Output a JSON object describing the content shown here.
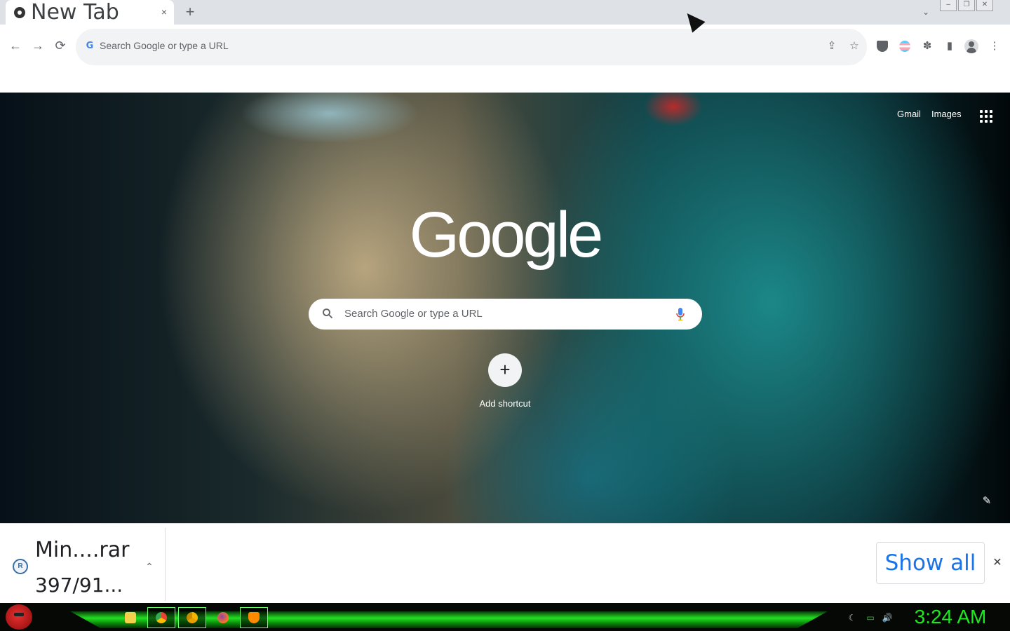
{
  "browser": {
    "tab": {
      "title": "New Tab",
      "close_icon": "×"
    },
    "new_tab_icon": "+",
    "tab_search_icon": "⌄",
    "window_controls": [
      "–",
      "❐",
      "✕"
    ],
    "nav": {
      "back_icon": "←",
      "forward_icon": "→",
      "reload_icon": "⟳"
    },
    "omnibox": {
      "placeholder": "Search Google or type a URL",
      "google_icon": "G"
    },
    "actions": {
      "share_icon": "⇪",
      "bookmark_icon": "☆",
      "extensions_icon": "✽",
      "sidepanel_icon": "▮",
      "menu_icon": "⋮"
    }
  },
  "ntp": {
    "links": {
      "gmail": "Gmail",
      "images": "Images"
    },
    "logo": "Google",
    "search_placeholder": "Search Google or type a URL",
    "shortcut": {
      "icon": "+",
      "label": "Add shortcut"
    },
    "customize_icon": "✎"
  },
  "download_shelf": {
    "item": {
      "name": "Min....rar",
      "status": "397/91...",
      "icon": "R"
    },
    "caret": "⌃",
    "show_all": "Show all",
    "close": "✕"
  },
  "taskbar": {
    "clock": "3:24 AM",
    "apps": [
      "file-explorer-icon",
      "chrome-icon",
      "chrome-canary-icon",
      "firefox-icon",
      "vlc-icon"
    ],
    "tray": {
      "moon_icon": "☾",
      "network_icon": "▭",
      "volume_icon": "🔊"
    }
  },
  "colors": {
    "accent": "#1a73e8",
    "taskbar_green": "#22e022",
    "clock_green": "#1ee81e"
  }
}
